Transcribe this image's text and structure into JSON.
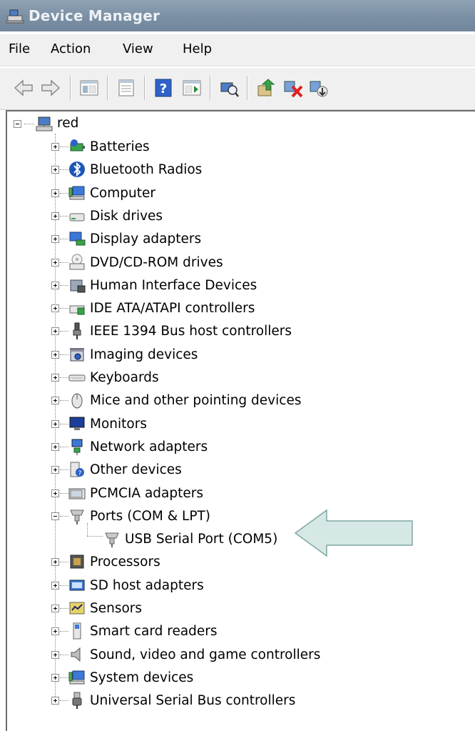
{
  "window": {
    "title": "Device Manager",
    "title_icon": "device-manager-icon"
  },
  "menu": {
    "items": [
      "File",
      "Action",
      "View",
      "Help"
    ]
  },
  "toolbar": {
    "buttons": [
      "back-icon",
      "forward-icon",
      "show-hide-console-tree-icon",
      "properties-icon",
      "help-icon",
      "show-hide-action-pane-icon",
      "scan-hardware-icon",
      "update-driver-icon",
      "disable-device-icon",
      "uninstall-device-icon"
    ]
  },
  "tree": {
    "root": {
      "label": "red",
      "icon": "computer-icon",
      "expanded": true
    },
    "categories": [
      {
        "label": "Batteries",
        "icon": "battery-icon"
      },
      {
        "label": "Bluetooth Radios",
        "icon": "bluetooth-icon"
      },
      {
        "label": "Computer",
        "icon": "computer-icon"
      },
      {
        "label": "Disk drives",
        "icon": "disk-drive-icon"
      },
      {
        "label": "Display adapters",
        "icon": "display-adapter-icon"
      },
      {
        "label": "DVD/CD-ROM drives",
        "icon": "dvd-drive-icon"
      },
      {
        "label": "Human Interface Devices",
        "icon": "hid-icon"
      },
      {
        "label": "IDE ATA/ATAPI controllers",
        "icon": "ide-controller-icon"
      },
      {
        "label": "IEEE 1394 Bus host controllers",
        "icon": "ieee1394-icon"
      },
      {
        "label": "Imaging devices",
        "icon": "camera-icon"
      },
      {
        "label": "Keyboards",
        "icon": "keyboard-icon"
      },
      {
        "label": "Mice and other pointing devices",
        "icon": "mouse-icon"
      },
      {
        "label": "Monitors",
        "icon": "monitor-icon"
      },
      {
        "label": "Network adapters",
        "icon": "network-adapter-icon"
      },
      {
        "label": "Other devices",
        "icon": "unknown-device-icon"
      },
      {
        "label": "PCMCIA adapters",
        "icon": "pcmcia-icon"
      },
      {
        "label": "Ports (COM & LPT)",
        "icon": "port-icon",
        "expanded": true,
        "children": [
          {
            "label": "USB Serial Port (COM5)",
            "icon": "port-icon"
          }
        ]
      },
      {
        "label": "Processors",
        "icon": "processor-icon"
      },
      {
        "label": "SD host adapters",
        "icon": "sd-adapter-icon"
      },
      {
        "label": "Sensors",
        "icon": "sensor-icon"
      },
      {
        "label": "Smart card readers",
        "icon": "smart-card-reader-icon"
      },
      {
        "label": "Sound, video and game controllers",
        "icon": "speaker-icon"
      },
      {
        "label": "System devices",
        "icon": "system-device-icon"
      },
      {
        "label": "Universal Serial Bus controllers",
        "icon": "usb-icon"
      }
    ]
  },
  "annotation": {
    "shape": "arrow-left",
    "fill": "#d6e8e6",
    "stroke": "#7fa7a3"
  }
}
